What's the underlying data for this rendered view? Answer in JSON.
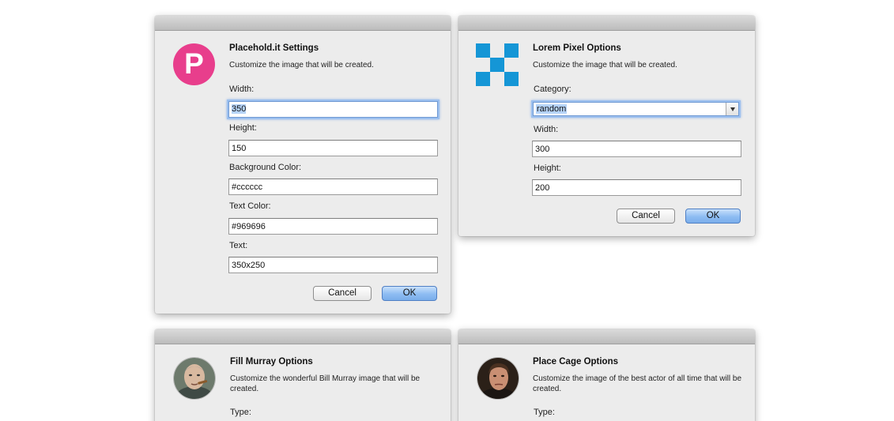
{
  "colors": {
    "placeholdit_logo": "#e83e8c",
    "lorempixel_logo": "#1596d6",
    "primary_button": "#7aaeeb"
  },
  "placeholdit": {
    "logo_icon": "placeholdit-p-icon",
    "logo_letter": "P",
    "title": "Placehold.it Settings",
    "subtitle": "Customize the image that will be created.",
    "fields": [
      {
        "label": "Width:",
        "value": "350"
      },
      {
        "label": "Height:",
        "value": "150"
      },
      {
        "label": "Background Color:",
        "value": "#cccccc"
      },
      {
        "label": "Text Color:",
        "value": "#969696"
      },
      {
        "label": "Text:",
        "value": "350x250"
      }
    ],
    "cancel_label": "Cancel",
    "ok_label": "OK"
  },
  "lorempixel": {
    "logo_icon": "checkerboard-icon",
    "title": "Lorem Pixel Options",
    "subtitle": "Customize the image that will be created.",
    "category_label": "Category:",
    "category_value": "random",
    "width_label": "Width:",
    "width_value": "300",
    "height_label": "Height:",
    "height_value": "200",
    "cancel_label": "Cancel",
    "ok_label": "OK"
  },
  "fillmurray": {
    "avatar_icon": "bill-murray-avatar",
    "title": "Fill Murray Options",
    "subtitle": "Customize the wonderful Bill Murray image that will be created.",
    "type_label": "Type:"
  },
  "placecage": {
    "avatar_icon": "nicolas-cage-avatar",
    "title": "Place Cage Options",
    "subtitle": "Customize the image of the best actor of all time that will be created.",
    "type_label": "Type:"
  }
}
